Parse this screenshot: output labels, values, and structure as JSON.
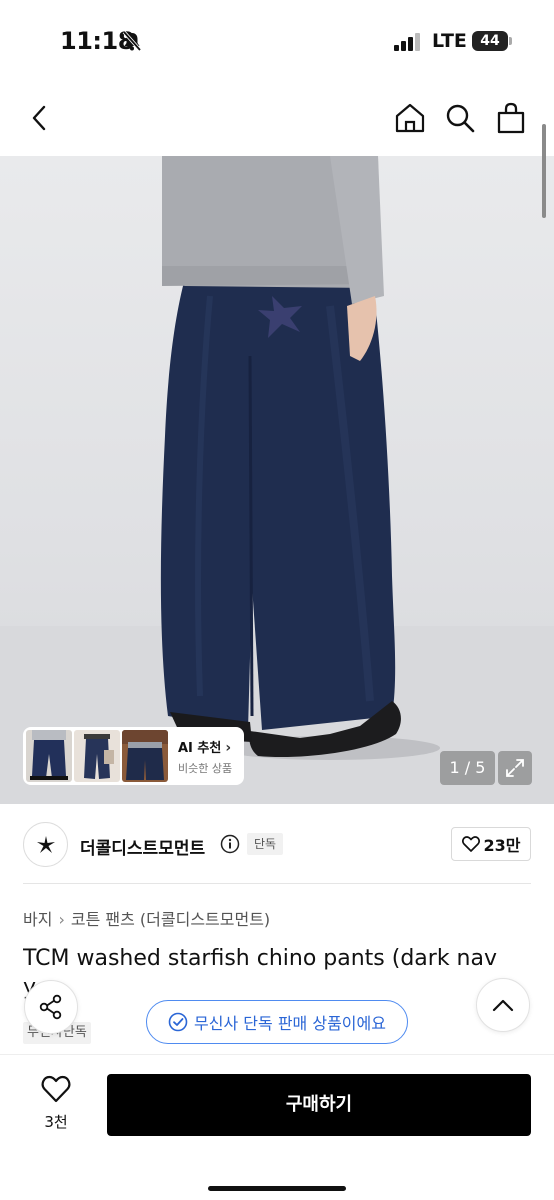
{
  "status_bar": {
    "time": "11:18",
    "network": "LTE",
    "battery": "44"
  },
  "nav": {
    "icons": [
      "back-arrow-icon",
      "home-icon",
      "search-icon",
      "shopping-bag-icon"
    ]
  },
  "gallery": {
    "ai_label": "AI 추천",
    "ai_sublabel": "비슷한 상품",
    "page_counter": "1 / 5"
  },
  "brand": {
    "name": "더콜디스트모먼트",
    "exclusive_tag": "단독",
    "likes": "23만"
  },
  "breadcrumb": [
    "바지",
    "코튼 팬츠",
    "(더콜디스트모먼트)"
  ],
  "product": {
    "title": "TCM washed starfish chino pants (dark nav",
    "title_overflow": "y",
    "badge": "무신사단독"
  },
  "notice": {
    "label": "무신사 단독 판매 상품이에요"
  },
  "bottom_bar": {
    "wish_count": "3천",
    "buy_label": "구매하기"
  },
  "colors": {
    "notice_blue": "#2b66d6",
    "pants_navy": "#1f2d4f",
    "sweater_gray": "#a9abb0"
  }
}
